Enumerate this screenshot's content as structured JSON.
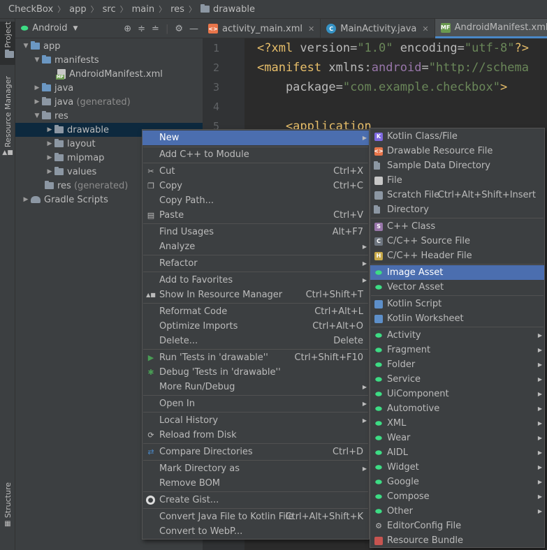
{
  "breadcrumb": [
    "CheckBox",
    "app",
    "src",
    "main",
    "res",
    "drawable"
  ],
  "side_tabs": {
    "project": "Project",
    "resource_manager": "Resource Manager",
    "structure": "Structure"
  },
  "project_panel": {
    "view_selector": "Android",
    "tree": [
      {
        "label": "app",
        "muted": ""
      },
      {
        "label": "manifests",
        "muted": ""
      },
      {
        "label": "AndroidManifest.xml",
        "muted": ""
      },
      {
        "label": "java",
        "muted": ""
      },
      {
        "label": "java",
        "muted": "(generated)"
      },
      {
        "label": "res",
        "muted": ""
      },
      {
        "label": "drawable",
        "muted": ""
      },
      {
        "label": "layout",
        "muted": ""
      },
      {
        "label": "mipmap",
        "muted": ""
      },
      {
        "label": "values",
        "muted": ""
      },
      {
        "label": "res",
        "muted": "(generated)"
      },
      {
        "label": "Gradle Scripts",
        "muted": ""
      }
    ]
  },
  "editor_tabs": [
    {
      "label": "activity_main.xml"
    },
    {
      "label": "MainActivity.java"
    },
    {
      "label": "AndroidManifest.xml"
    }
  ],
  "editor": {
    "line_numbers": [
      "1",
      "2",
      "3",
      "4",
      "5"
    ],
    "lines": {
      "l1_open": "<?xml ",
      "l1_a1": "version=",
      "l1_s1": "\"1.0\"",
      "l1_a2": " encoding=",
      "l1_s2": "\"utf-8\"",
      "l1_close": "?>",
      "l2_tag": "<manifest ",
      "l2_attr": "xmlns:",
      "l2_ns": "android",
      "l2_eq": "=",
      "l2_str": "\"http://schema",
      "l3_attr": "    package=",
      "l3_str": "\"com.example.checkbox\"",
      "l3_close": ">",
      "l5_tag": "    <application"
    }
  },
  "context_menu": [
    {
      "label": "New",
      "shortcut": "",
      "submenu": true
    },
    {
      "label": "Add C++ to Module",
      "shortcut": ""
    },
    {
      "label": "Cut",
      "shortcut": "Ctrl+X"
    },
    {
      "label": "Copy",
      "shortcut": "Ctrl+C"
    },
    {
      "label": "Copy Path...",
      "shortcut": ""
    },
    {
      "label": "Paste",
      "shortcut": "Ctrl+V"
    },
    {
      "label": "Find Usages",
      "shortcut": "Alt+F7"
    },
    {
      "label": "Analyze",
      "shortcut": "",
      "submenu": true
    },
    {
      "label": "Refactor",
      "shortcut": "",
      "submenu": true
    },
    {
      "label": "Add to Favorites",
      "shortcut": "",
      "submenu": true
    },
    {
      "label": "Show In Resource Manager",
      "shortcut": "Ctrl+Shift+T"
    },
    {
      "label": "Reformat Code",
      "shortcut": "Ctrl+Alt+L"
    },
    {
      "label": "Optimize Imports",
      "shortcut": "Ctrl+Alt+O"
    },
    {
      "label": "Delete...",
      "shortcut": "Delete"
    },
    {
      "label": "Run 'Tests in 'drawable''",
      "shortcut": "Ctrl+Shift+F10"
    },
    {
      "label": "Debug 'Tests in 'drawable''",
      "shortcut": ""
    },
    {
      "label": "More Run/Debug",
      "shortcut": "",
      "submenu": true
    },
    {
      "label": "Open In",
      "shortcut": "",
      "submenu": true
    },
    {
      "label": "Local History",
      "shortcut": "",
      "submenu": true
    },
    {
      "label": "Reload from Disk",
      "shortcut": ""
    },
    {
      "label": "Compare Directories",
      "shortcut": "Ctrl+D"
    },
    {
      "label": "Mark Directory as",
      "shortcut": "",
      "submenu": true
    },
    {
      "label": "Remove BOM",
      "shortcut": ""
    },
    {
      "label": "Create Gist...",
      "shortcut": ""
    },
    {
      "label": "Convert Java File to Kotlin File",
      "shortcut": "Ctrl+Alt+Shift+K"
    },
    {
      "label": "Convert to WebP...",
      "shortcut": ""
    }
  ],
  "new_submenu": [
    {
      "label": "Kotlin Class/File",
      "shortcut": ""
    },
    {
      "label": "Drawable Resource File",
      "shortcut": ""
    },
    {
      "label": "Sample Data Directory",
      "shortcut": ""
    },
    {
      "label": "File",
      "shortcut": ""
    },
    {
      "label": "Scratch File",
      "shortcut": "Ctrl+Alt+Shift+Insert"
    },
    {
      "label": "Directory",
      "shortcut": ""
    },
    {
      "label": "C++ Class",
      "shortcut": ""
    },
    {
      "label": "C/C++ Source File",
      "shortcut": ""
    },
    {
      "label": "C/C++ Header File",
      "shortcut": ""
    },
    {
      "label": "Image Asset",
      "shortcut": ""
    },
    {
      "label": "Vector Asset",
      "shortcut": ""
    },
    {
      "label": "Kotlin Script",
      "shortcut": ""
    },
    {
      "label": "Kotlin Worksheet",
      "shortcut": ""
    },
    {
      "label": "Activity",
      "shortcut": ""
    },
    {
      "label": "Fragment",
      "shortcut": ""
    },
    {
      "label": "Folder",
      "shortcut": ""
    },
    {
      "label": "Service",
      "shortcut": ""
    },
    {
      "label": "UiComponent",
      "shortcut": ""
    },
    {
      "label": "Automotive",
      "shortcut": ""
    },
    {
      "label": "XML",
      "shortcut": ""
    },
    {
      "label": "Wear",
      "shortcut": ""
    },
    {
      "label": "AIDL",
      "shortcut": ""
    },
    {
      "label": "Widget",
      "shortcut": ""
    },
    {
      "label": "Google",
      "shortcut": ""
    },
    {
      "label": "Compose",
      "shortcut": ""
    },
    {
      "label": "Other",
      "shortcut": ""
    },
    {
      "label": "EditorConfig File",
      "shortcut": ""
    },
    {
      "label": "Resource Bundle",
      "shortcut": ""
    }
  ],
  "colors": {
    "highlight": "#4b6eaf",
    "selection": "#0d293e",
    "android_green": "#3ddc84"
  }
}
